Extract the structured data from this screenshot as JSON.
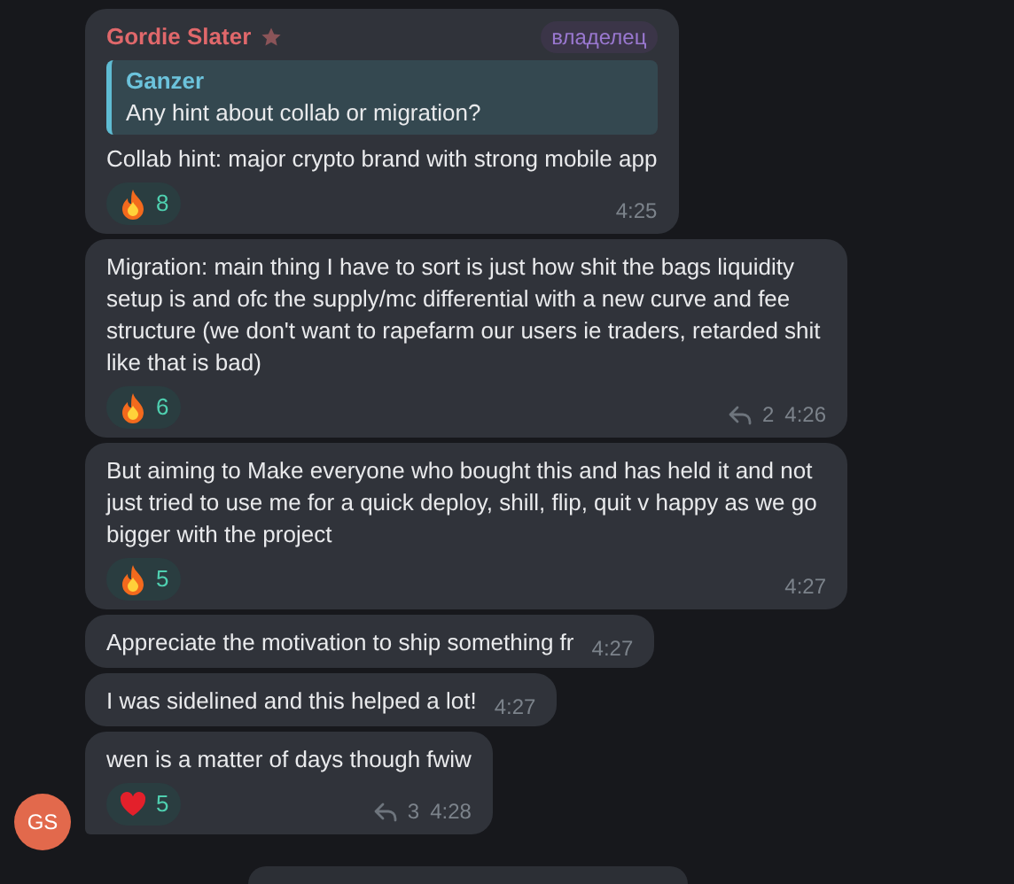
{
  "messages": [
    {
      "author": "Gordie Slater",
      "starred": true,
      "badge": "владелец",
      "reply": {
        "author": "Ganzer",
        "text": "Any hint about collab or migration?"
      },
      "text": "Collab hint: major crypto brand with strong mobile app",
      "reactions": [
        {
          "kind": "fire",
          "count": "8"
        }
      ],
      "time": "4:25"
    },
    {
      "text": "Migration: main thing I have to sort is just how shit the bags liquidity setup is and ofc the supply/mc differential with a new curve and fee structure (we don't want to rapefarm our users ie traders, retarded shit like that is bad)",
      "reactions": [
        {
          "kind": "fire",
          "count": "6"
        }
      ],
      "replies": "2",
      "time": "4:26"
    },
    {
      "text": "But aiming to Make everyone who bought this and has held it and not just tried to use me for a quick deploy, shill, flip, quit v happy as we go bigger with the project",
      "reactions": [
        {
          "kind": "fire",
          "count": "5"
        }
      ],
      "time": "4:27"
    },
    {
      "text": "Appreciate the motivation to ship something fr",
      "time": "4:27"
    },
    {
      "text": "I was sidelined and this helped a lot!",
      "time": "4:27"
    },
    {
      "text": "wen is a matter of days though fwiw",
      "reactions": [
        {
          "kind": "heart",
          "count": "5"
        }
      ],
      "replies": "3",
      "time": "4:28"
    }
  ],
  "avatar": {
    "initials": "GS"
  }
}
